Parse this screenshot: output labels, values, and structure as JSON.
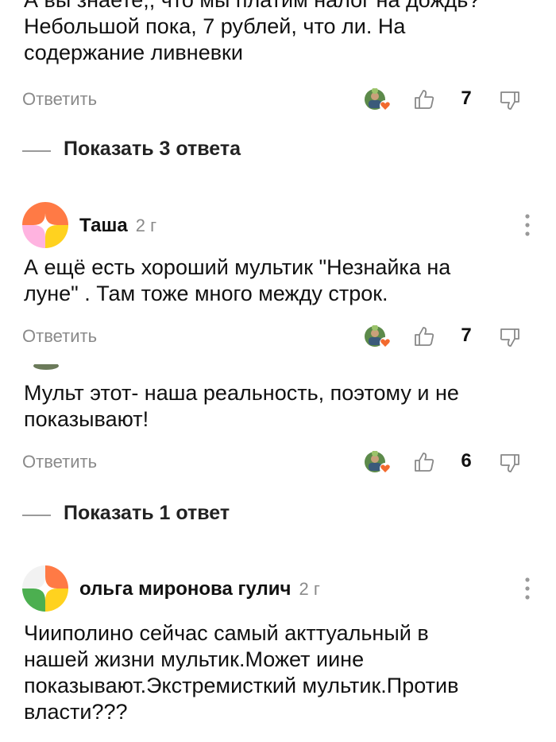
{
  "comment1": {
    "text_lines": [
      "А вы знаете,, что мы платим налог на дождь?",
      "Небольшой пока, 7 рублей, что ли. На",
      "содержание ливневки"
    ],
    "reply_label": "Ответить",
    "like_count": "7",
    "show_replies": "Показать 3 ответа"
  },
  "comment2": {
    "author": "Таша",
    "time": "2 г",
    "text_lines": [
      "А ещё есть хороший мультик \"Незнайка на",
      "луне\" . Там тоже много между строк."
    ],
    "reply_label": "Ответить",
    "like_count": "7"
  },
  "comment3": {
    "text_lines": [
      "Мульт этот- наша реальность, поэтому и не",
      "показывают!"
    ],
    "reply_label": "Ответить",
    "like_count": "6",
    "show_replies": "Показать 1 ответ"
  },
  "comment4": {
    "author": "ольга миронова гулич",
    "time": "2 г",
    "text_lines": [
      "Чииполино сейчас самый акттуальный в",
      "нашей жизни мультик.Может иине",
      "показывают.Экстремисткий мультик.Против",
      "власти???"
    ]
  },
  "colors": {
    "reaction_heart": "#f26a2e",
    "muted_text": "#8a8a8a",
    "icon_gray": "#888888"
  },
  "icons": [
    "reactor-avatar-icon",
    "like-icon",
    "dislike-icon",
    "more-vertical-icon",
    "author-avatar"
  ]
}
